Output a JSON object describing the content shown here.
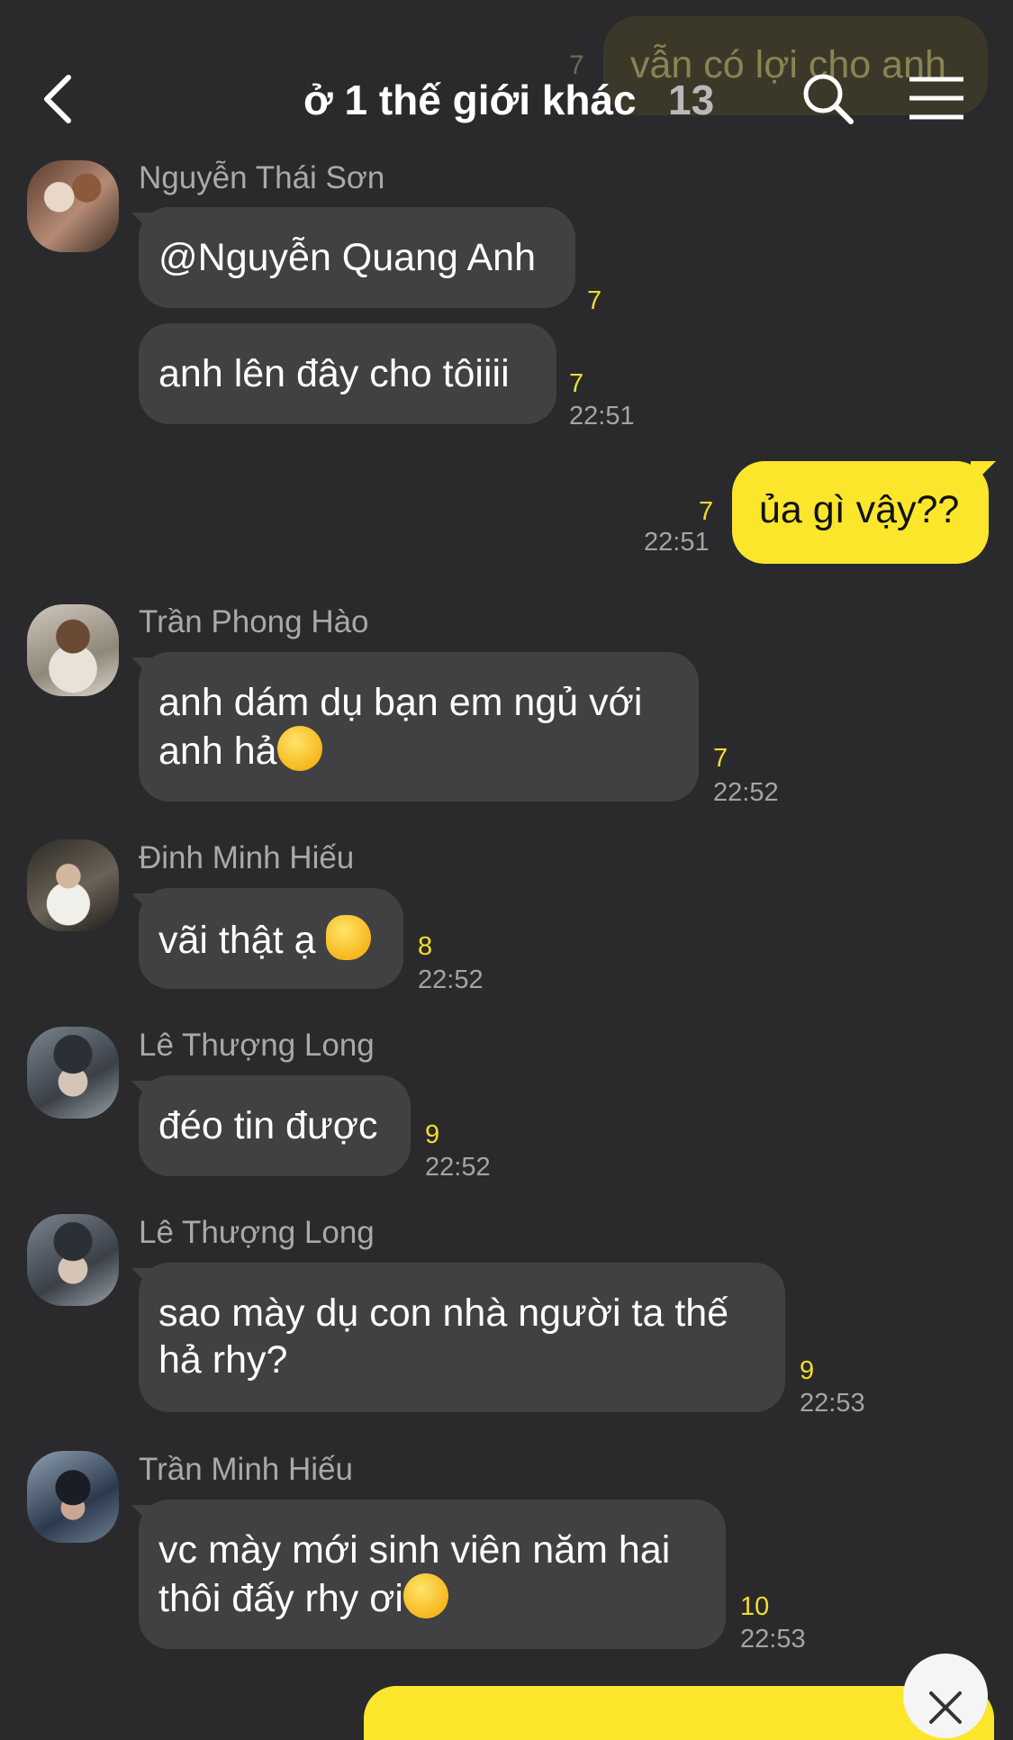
{
  "header": {
    "title": "ở 1 thế giới khác",
    "member_count": "13",
    "ghost_preview": "vẫn có lợi cho anh",
    "ghost_unread": "7"
  },
  "messages": [
    {
      "sender": "Nguyễn Thái Sơn",
      "text": "@Nguyễn Quang Anh",
      "unread": "7",
      "time": ""
    },
    {
      "sender": "",
      "text": "anh lên đây cho tôiiii",
      "unread": "7",
      "time": "22:51"
    },
    {
      "sender": "me",
      "text": "ủa gì vậy??",
      "unread": "7",
      "time": "22:51"
    },
    {
      "sender": "Trần Phong Hào",
      "text_line1": "anh dám dụ bạn em ngủ với",
      "text_line2": "anh hả",
      "emoji": "huffing-face",
      "unread": "7",
      "time": "22:52"
    },
    {
      "sender": "Đinh Minh Hiếu",
      "text": "vãi thật ạ",
      "emoji": "pointing-hand",
      "unread": "8",
      "time": "22:52"
    },
    {
      "sender": "Lê Thượng Long",
      "text": "đéo tin được",
      "unread": "9",
      "time": "22:52"
    },
    {
      "sender": "Lê Thượng Long",
      "text_line1": "sao mày dụ con nhà người ta thế",
      "text_line2": "hả rhy?",
      "unread": "9",
      "time": "22:53"
    },
    {
      "sender": "Trần Minh Hiếu",
      "text_line1": "vc mày mới sinh viên năm hai",
      "text_line2": "thôi đấy rhy ơi",
      "emoji": "raised-eyebrow-face",
      "unread": "10",
      "time": "22:53"
    }
  ],
  "colors": {
    "background": "#2a2a2c",
    "bubble_other": "#414143",
    "bubble_me": "#fbe62c",
    "unread": "#f3dd2c"
  }
}
